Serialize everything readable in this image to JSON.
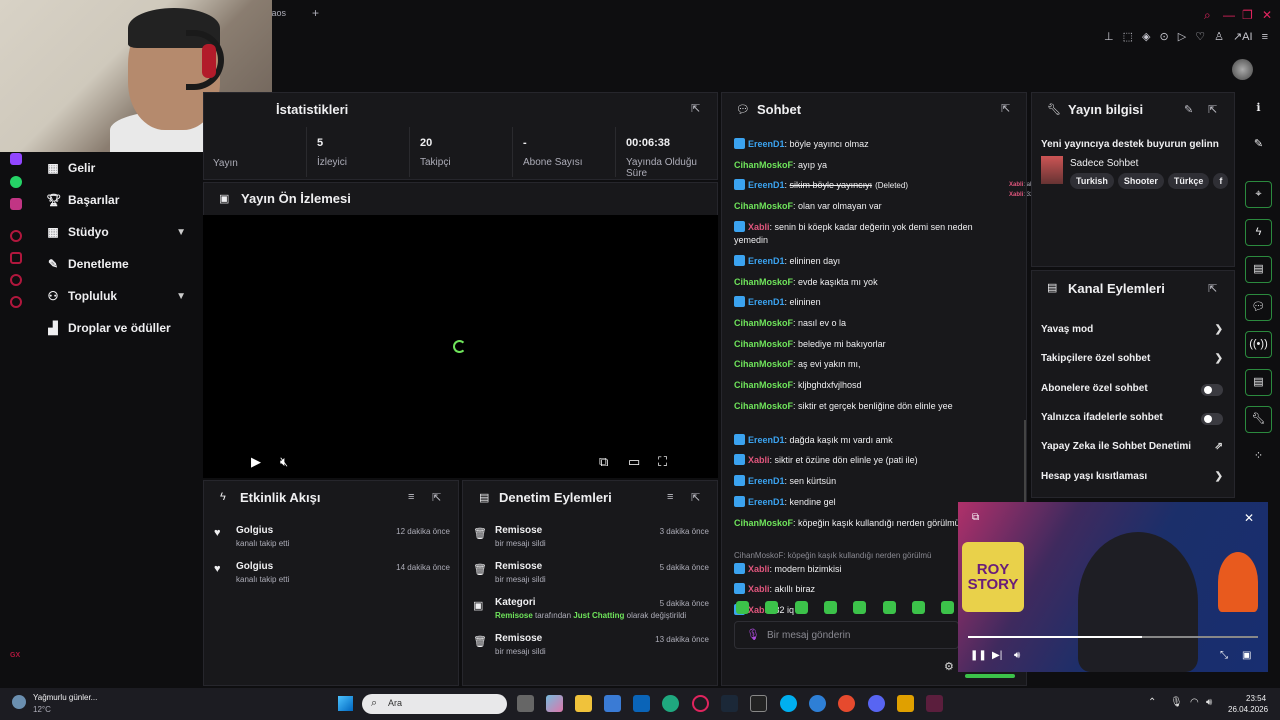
{
  "browser": {
    "tab_title": "e Kaos",
    "new_tab": "+",
    "extension_label": "AI"
  },
  "sidebar": {
    "items": [
      {
        "label": "Gelir",
        "icon": "grid-icon"
      },
      {
        "label": "Başarılar",
        "icon": "trophy-icon"
      },
      {
        "label": "Stüdyo",
        "icon": "grid-icon",
        "expandable": true
      },
      {
        "label": "Denetleme",
        "icon": "wrench-icon"
      },
      {
        "label": "Topluluk",
        "icon": "people-icon",
        "expandable": true
      },
      {
        "label": "Droplar ve ödüller",
        "icon": "chart-icon"
      }
    ],
    "footer": "GX"
  },
  "stats": {
    "title": "İstatistikleri",
    "items": [
      {
        "value": "",
        "label": "Yayın"
      },
      {
        "value": "5",
        "label": "İzleyici"
      },
      {
        "value": "20",
        "label": "Takipçi"
      },
      {
        "value": "-",
        "label": "Abone Sayısı"
      },
      {
        "value": "00:06:38",
        "label": "Yayında Olduğu Süre"
      }
    ]
  },
  "preview": {
    "title": "Yayın Ön İzlemesi"
  },
  "activity": {
    "title": "Etkinlik Akışı",
    "items": [
      {
        "user": "Golgius",
        "action": "kanalı takip etti",
        "time": "12 dakika önce"
      },
      {
        "user": "Golgius",
        "action": "kanalı takip etti",
        "time": "14 dakika önce"
      }
    ]
  },
  "moderation": {
    "title": "Denetim Eylemleri",
    "items": [
      {
        "user": "Remisose",
        "action": "bir mesajı sildi",
        "time": "3 dakika önce"
      },
      {
        "user": "Remisose",
        "action": "bir mesajı sildi",
        "time": "5 dakika önce"
      },
      {
        "user": "Kategori",
        "action_prefix": "Remisose",
        "action_mid": " tarafından ",
        "action_cat": "Just Chatting",
        "action_end": " olarak değiştirildi",
        "time": "5 dakika önce"
      },
      {
        "user": "Remisose",
        "action": "bir mesajı sildi",
        "time": "13 dakika önce"
      }
    ]
  },
  "chat": {
    "title": "Sohbet",
    "placeholder": "Bir mesaj gönderin",
    "messages": [
      {
        "user": "EreenD1",
        "color": "blue",
        "badge": true,
        "text": "böyle yayıncı olmaz"
      },
      {
        "user": "CihanMoskoF",
        "color": "green",
        "badge": false,
        "text": "ayıp ya"
      },
      {
        "user": "EreenD1",
        "color": "blue",
        "badge": true,
        "text": "sikim böyle yayıncıyı",
        "deleted": "(Deleted)"
      },
      {
        "user": "CihanMoskoF",
        "color": "green",
        "badge": false,
        "text": "olan var olmayan var"
      },
      {
        "user": "Xabli",
        "color": "pink",
        "badge": true,
        "text": "senin bi köepk kadar değerin yok demi sen neden yemedin"
      },
      {
        "user": "EreenD1",
        "color": "blue",
        "badge": true,
        "text": "elininen dayı"
      },
      {
        "user": "CihanMoskoF",
        "color": "green",
        "badge": false,
        "text": "evde kaşıkta mı yok"
      },
      {
        "user": "EreenD1",
        "color": "blue",
        "badge": true,
        "text": "elininen"
      },
      {
        "user": "CihanMoskoF",
        "color": "green",
        "badge": false,
        "text": "nasıl ev o la"
      },
      {
        "user": "CihanMoskoF",
        "color": "green",
        "badge": false,
        "text": "belediye mi bakıyorlar"
      },
      {
        "user": "CihanMoskoF",
        "color": "green",
        "badge": false,
        "text": "aş evi yakın mı,"
      },
      {
        "user": "CihanMoskoF",
        "color": "green",
        "badge": false,
        "text": "kljbghdxfvjlhosd"
      },
      {
        "user": "CihanMoskoF",
        "color": "green",
        "badge": false,
        "text": "siktir et gerçek benliğine dön elinle yee"
      },
      {
        "user": "EreenD1",
        "color": "blue",
        "badge": true,
        "text": "dağda kaşık mı vardı amk"
      },
      {
        "user": "Xabli",
        "color": "pink",
        "badge": true,
        "text": "siktir et özüne dön elinle ye (pati ile)"
      },
      {
        "user": "EreenD1",
        "color": "blue",
        "badge": true,
        "text": "sen kürtsün"
      },
      {
        "user": "EreenD1",
        "color": "blue",
        "badge": true,
        "text": "kendine gel"
      },
      {
        "user": "CihanMoskoF",
        "color": "green",
        "badge": false,
        "text": "köpeğin kaşık kullandığı nerden görülmü"
      },
      {
        "user": "Xabli",
        "color": "pink",
        "badge": true,
        "text": "modern bizimkisi",
        "reply": "CihanMoskoF: köpeğin kaşık kullandığı nerden görülmü"
      },
      {
        "user": "Xabli",
        "color": "pink",
        "badge": true,
        "text": "akıllı biraz"
      },
      {
        "user": "Xabli",
        "color": "pink",
        "badge": true,
        "text": "32 iq"
      }
    ],
    "side_notes": [
      "Xabli: akıllı biraz",
      "Xabli: 32 iq"
    ]
  },
  "stream_info": {
    "title": "Yayın bilgisi",
    "stream_title": "Yeni yayıncıya destek buyurun gelinn",
    "category": "Sadece Sohbet",
    "tags": [
      "Turkish",
      "Shooter",
      "Türkçe",
      "f"
    ]
  },
  "channel_actions": {
    "title": "Kanal Eylemleri",
    "items": [
      {
        "label": "Yavaş mod",
        "kind": "chevron"
      },
      {
        "label": "Takipçilere özel sohbet",
        "kind": "chevron"
      },
      {
        "label": "Abonelere özel sohbet",
        "kind": "toggle"
      },
      {
        "label": "Yalnızca ifadelerle sohbet",
        "kind": "toggle"
      },
      {
        "label": "Yapay Zeka ile Sohbet Denetimi",
        "kind": "external"
      },
      {
        "label": "Hesap yaşı kısıtlaması",
        "kind": "chevron"
      }
    ]
  },
  "pip": {
    "poster_line1": "ROY",
    "poster_line2": "STORY",
    "progress": 0.6
  },
  "taskbar": {
    "weather_title": "Yağmurlu günler...",
    "weather_temp": "12°C",
    "search_placeholder": "Ara",
    "time": "23:54",
    "date": "26.04.2026"
  },
  "colors": {
    "accent_green": "#6fe45b",
    "user_blue": "#3ba3f0",
    "user_pink": "#e0567d",
    "panel": "#18181b"
  }
}
